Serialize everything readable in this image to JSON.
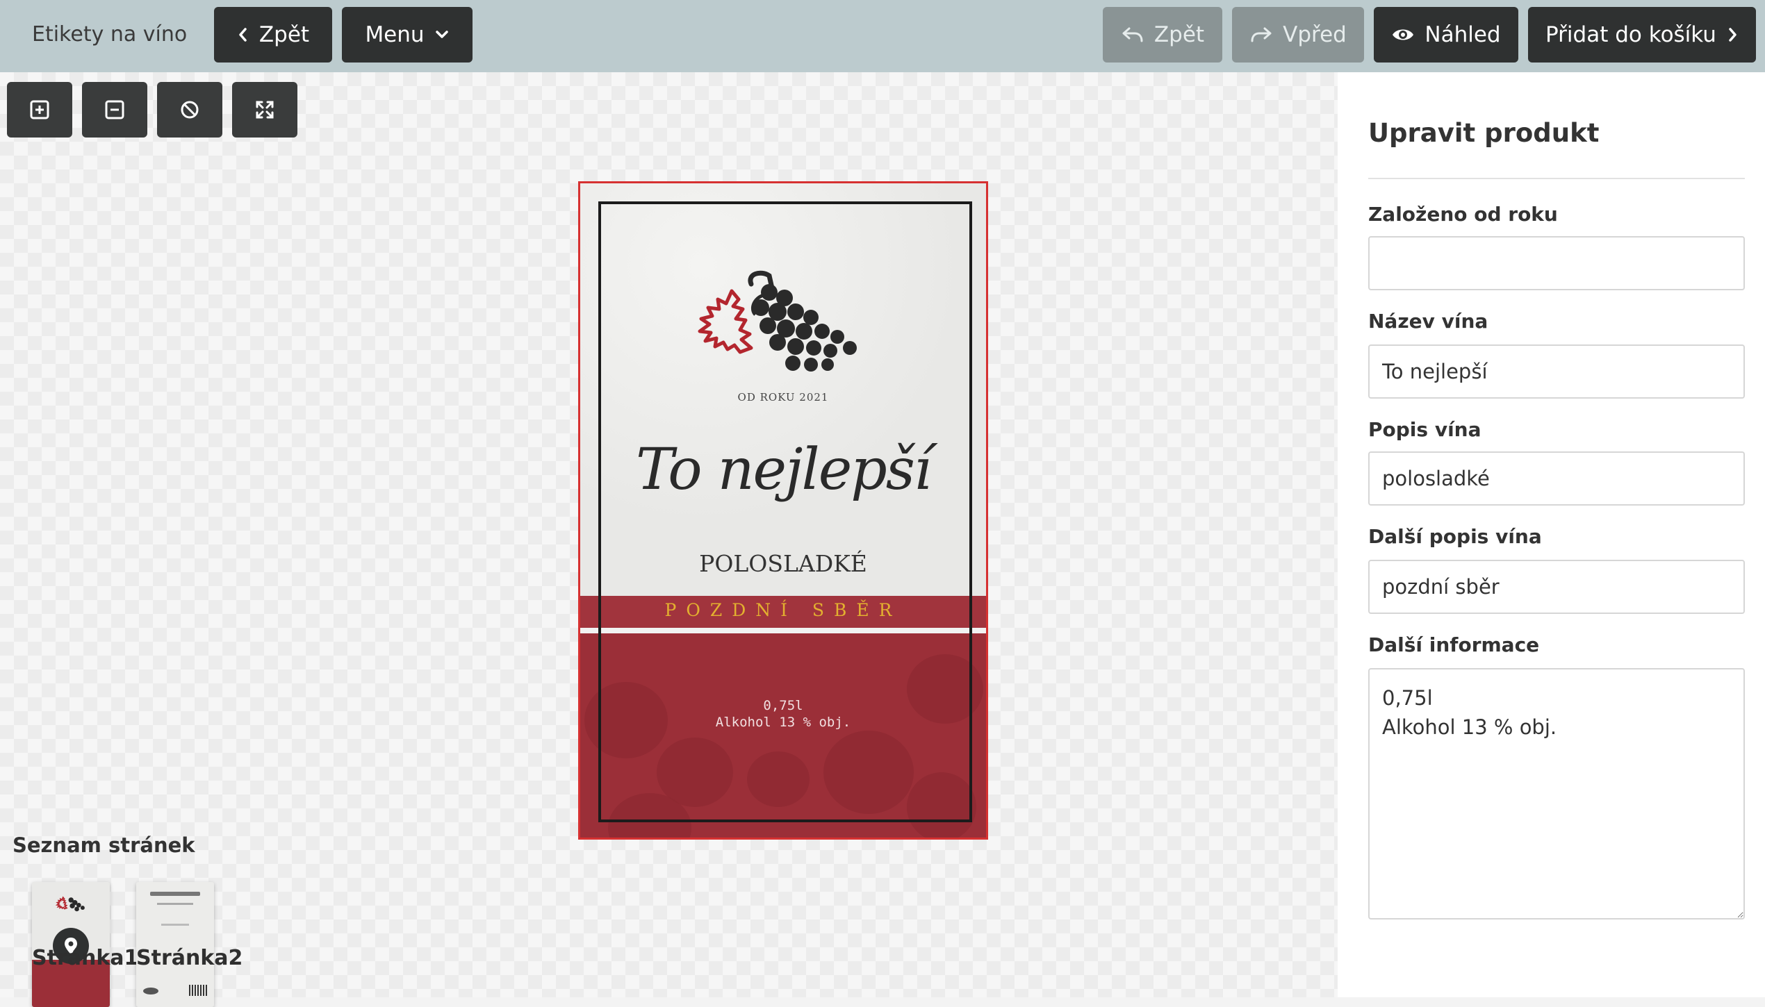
{
  "app": {
    "title": "Etikety na víno"
  },
  "topbar": {
    "back_label": "Zpět",
    "menu_label": "Menu",
    "undo_label": "Zpět",
    "redo_label": "Vpřed",
    "preview_label": "Náhled",
    "add_to_cart_label": "Přidat do košíku"
  },
  "toolbar": {
    "icons": [
      "zoom-in-icon",
      "zoom-out-icon",
      "reset-icon",
      "fullscreen-icon"
    ]
  },
  "label": {
    "since": "OD ROKU 2021",
    "wine_name": "To nejlepší",
    "description": "POLOSLADKÉ",
    "extra_description": "POZDNÍ SBĚR",
    "info_line1": "0,75l",
    "info_line2": "Alkohol 13 % obj.",
    "colors": {
      "accent": "#a1343d",
      "gold": "#e3b02f",
      "frame": "#d63131"
    }
  },
  "pages": {
    "title": "Seznam stránek",
    "items": [
      {
        "label": "Stránka1",
        "active": true
      },
      {
        "label": "Stránka2",
        "active": false
      }
    ]
  },
  "panel": {
    "title": "Upravit produkt",
    "fields": [
      {
        "label": "Založeno od roku",
        "value": ""
      },
      {
        "label": "Název vína",
        "value": "To nejlepší"
      },
      {
        "label": "Popis vína",
        "value": "polosladké"
      },
      {
        "label": "Další popis vína",
        "value": "pozdní sběr"
      },
      {
        "label": "Další informace",
        "value": "0,75l\nAlkohol 13 % obj."
      }
    ]
  }
}
